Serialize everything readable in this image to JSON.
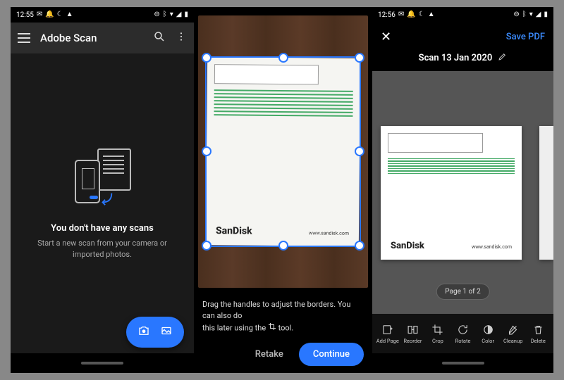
{
  "statusbar": {
    "time": "12:55",
    "time3": "12:56"
  },
  "col1": {
    "app_title": "Adobe Scan",
    "empty_title": "You don't have any scans",
    "empty_sub": "Start a new scan from your camera or imported photos."
  },
  "col2": {
    "tip_a": "Drag the handles to adjust the borders. You can also do",
    "tip_b": "this later using the",
    "tip_c": "tool.",
    "retake": "Retake",
    "continue": "Continue",
    "doc_logo": "SanDisk",
    "doc_url": "www.sandisk.com"
  },
  "col3": {
    "save_label": "Save PDF",
    "scan_title": "Scan 13 Jan 2020",
    "page_indicator": "Page 1 of 2",
    "doc_logo": "SanDisk",
    "doc_url": "www.sandisk.com",
    "tools": [
      {
        "n": "add-page",
        "l": "Add Page"
      },
      {
        "n": "reorder",
        "l": "Reorder"
      },
      {
        "n": "crop",
        "l": "Crop"
      },
      {
        "n": "rotate",
        "l": "Rotate"
      },
      {
        "n": "color",
        "l": "Color"
      },
      {
        "n": "cleanup",
        "l": "Cleanup"
      },
      {
        "n": "delete",
        "l": "Delete"
      }
    ]
  }
}
